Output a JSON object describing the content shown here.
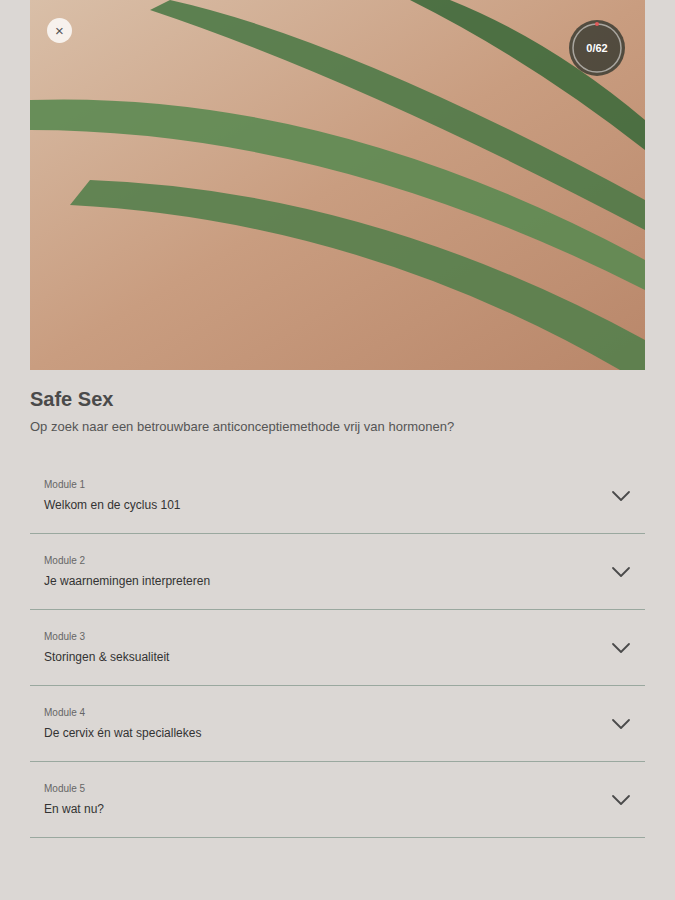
{
  "close_button": {
    "label": "×"
  },
  "progress": {
    "text": "0/62",
    "level": 0
  },
  "course": {
    "title": "Safe Sex",
    "subtitle": "Op zoek naar een betrouwbare anticonceptiemethode vrij van hormonen?"
  },
  "modules": [
    {
      "label": "Module 1",
      "title": "Welkom en de cyclus 101",
      "expanded": false
    },
    {
      "label": "Module 2",
      "title": "Je waarnemingen interpreteren",
      "expanded": false
    },
    {
      "label": "Module 3",
      "title": "Storingen & seksualiteit",
      "expanded": false
    },
    {
      "label": "Module 4",
      "title": "De cervix én wat speciallekes",
      "expanded": false
    },
    {
      "label": "Module 5",
      "title": "En wat nu?",
      "expanded": false
    }
  ]
}
